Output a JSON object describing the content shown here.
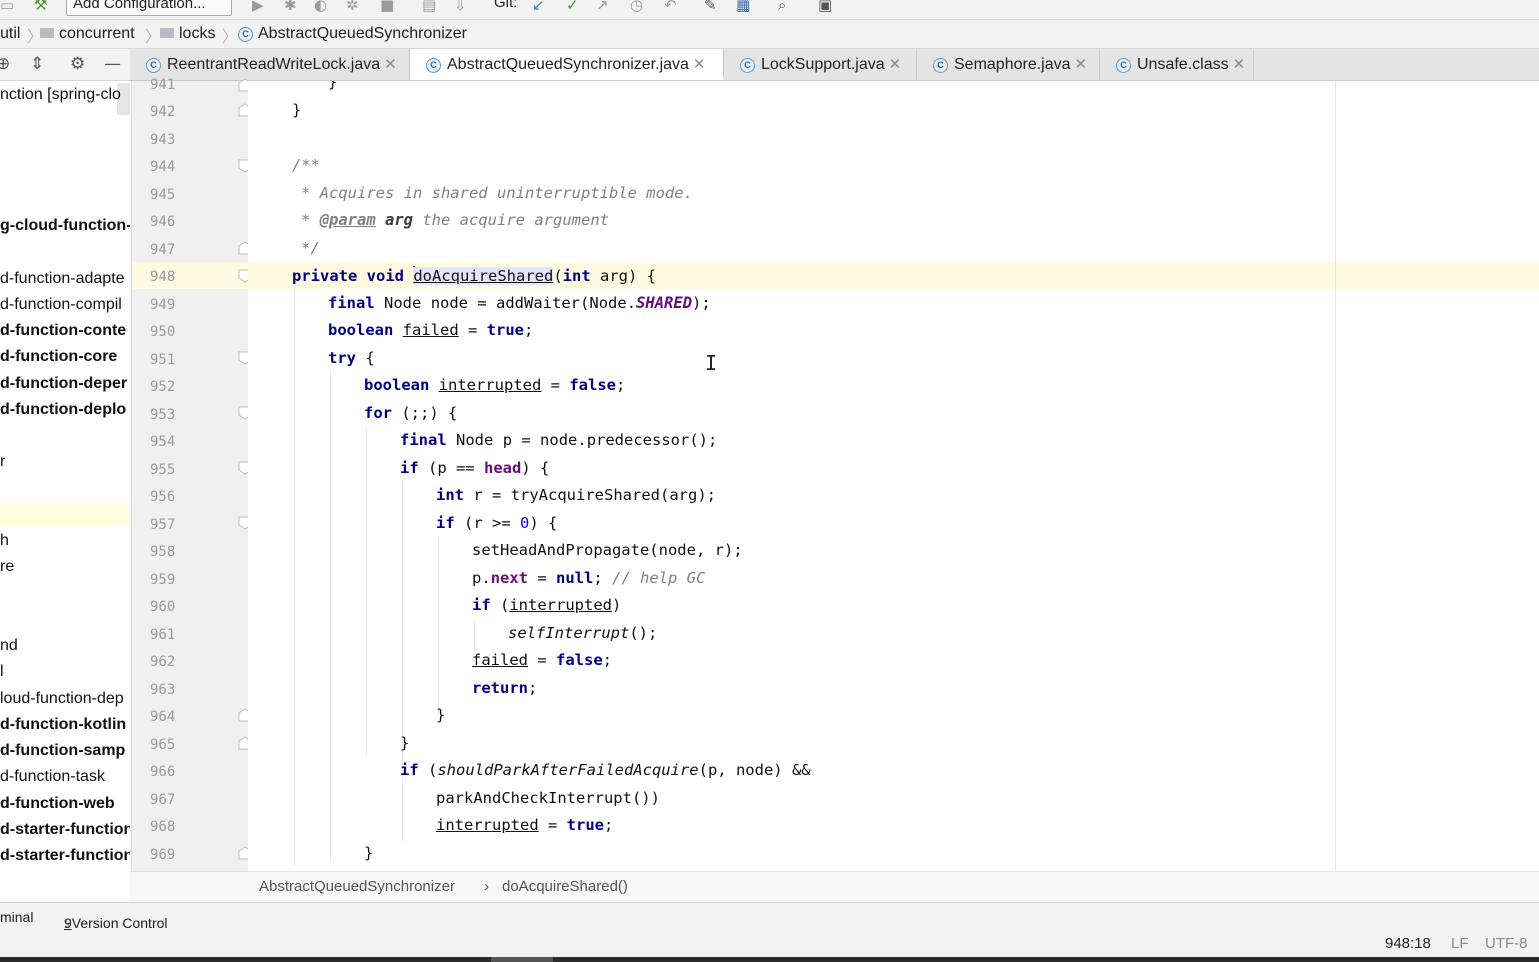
{
  "toolbar": {
    "run_config": "Add Configuration...",
    "git_label": "Git:"
  },
  "nav": {
    "crumbs": [
      "util",
      "concurrent",
      "locks",
      "AbstractQueuedSynchronizer"
    ]
  },
  "tabs": [
    {
      "label": "ReentrantReadWriteLock.java",
      "active": false
    },
    {
      "label": "AbstractQueuedSynchronizer.java",
      "active": true
    },
    {
      "label": "LockSupport.java",
      "active": false
    },
    {
      "label": "Semaphore.java",
      "active": false
    },
    {
      "label": "Unsafe.class",
      "active": false
    }
  ],
  "project": {
    "items": [
      {
        "text": "nction [spring-clo",
        "bold": false
      },
      {
        "text": "g-cloud-function-",
        "bold": true
      },
      {
        "text": "d-function-adapte",
        "bold": false
      },
      {
        "text": "d-function-compil",
        "bold": false
      },
      {
        "text": "d-function-conte",
        "bold": true
      },
      {
        "text": "d-function-core",
        "bold": true
      },
      {
        "text": "d-function-deper",
        "bold": true
      },
      {
        "text": "d-function-deplo",
        "bold": true
      },
      {
        "text": "r",
        "bold": false
      },
      {
        "text": "h",
        "bold": false
      },
      {
        "text": "re",
        "bold": false
      },
      {
        "text": "nd",
        "bold": false
      },
      {
        "text": "l",
        "bold": false
      },
      {
        "text": "loud-function-dep",
        "bold": false
      },
      {
        "text": "d-function-kotlin",
        "bold": true
      },
      {
        "text": "d-function-samp",
        "bold": true
      },
      {
        "text": "d-function-task",
        "bold": false
      },
      {
        "text": "d-function-web",
        "bold": true
      },
      {
        "text": "d-starter-function",
        "bold": true
      },
      {
        "text": "d-starter-function",
        "bold": true
      }
    ]
  },
  "editor": {
    "line_numbers": [
      "941",
      "942",
      "943",
      "944",
      "945",
      "946",
      "947",
      "948",
      "949",
      "950",
      "951",
      "952",
      "953",
      "954",
      "955",
      "956",
      "957",
      "958",
      "959",
      "960",
      "961",
      "962",
      "963",
      "964",
      "965",
      "966",
      "967",
      "968",
      "969"
    ],
    "code": {
      "l941": "}",
      "l942": "}",
      "l944": "/**",
      "l945": "* Acquires in shared uninterruptible mode.",
      "l946_tag": "@param",
      "l946_arg": "arg",
      "l946_rest": " the acquire argument",
      "l946_star": "* ",
      "l947": "*/",
      "private": "private",
      "void": "void",
      "method": "doAcquireShared",
      "int": "int",
      "arg_param": "arg",
      "final": "final",
      "Node": "Node",
      "node": "node",
      "addWaiter": "addWaiter",
      "SHARED": "SHARED",
      "boolean": "boolean",
      "failed": "failed",
      "true": "true",
      "false": "false",
      "try": "try",
      "interrupted": "interrupted",
      "for": "for",
      "forHead": "(;;) {",
      "p": "p",
      "predecessor": "node.predecessor();",
      "if": "if",
      "head": "head",
      "r": "r",
      "tryAcquireShared": "tryAcquireShared(arg);",
      "cond0": "(r >= ",
      "zero": "0",
      "setHead": "setHeadAndPropagate(node, r);",
      "next": "next",
      "null": "null",
      "helpGC": "// help GC",
      "selfInterrupt": "selfInterrupt",
      "return": "return",
      "shouldPark": "shouldParkAfterFailedAcquire",
      "shouldParkArgs": "(p, node) &&",
      "parkCheck": "parkAndCheckInterrupt())"
    }
  },
  "editor_crumbs": {
    "class": "AbstractQueuedSynchronizer",
    "sep": "›",
    "method": "doAcquireShared()"
  },
  "tool_windows": {
    "terminal": "minal",
    "vcs_num": "9",
    "vcs_label": ": Version Control"
  },
  "status": {
    "position": "948:18",
    "line_sep": "LF",
    "encoding": "UTF-8"
  }
}
